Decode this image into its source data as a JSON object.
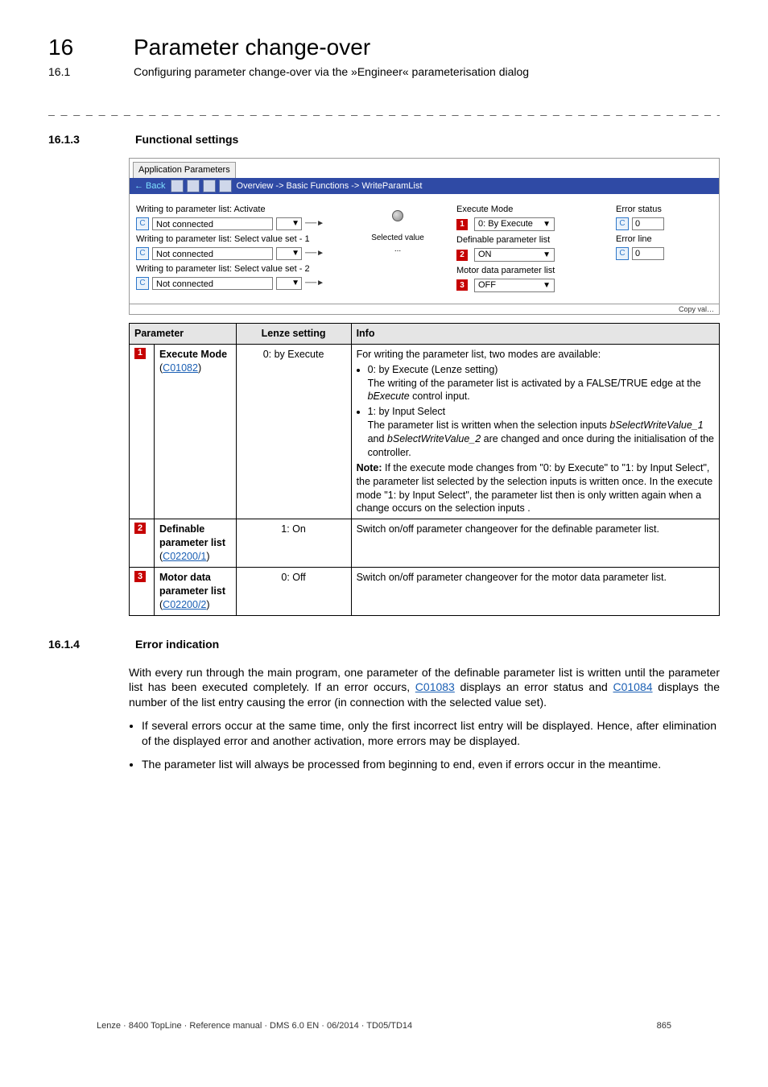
{
  "chapter": {
    "num": "16",
    "title": "Parameter change-over"
  },
  "sub": {
    "num": "16.1",
    "title": "Configuring parameter change-over via the »Engineer« parameterisation dialog"
  },
  "dashes": "_ _ _ _ _ _ _ _ _ _ _ _ _ _ _ _ _ _ _ _ _ _ _ _ _ _ _ _ _ _ _ _ _ _ _ _ _ _ _ _ _ _ _ _ _ _ _ _ _ _ _ _ _ _ _ _ _ _ _ _ _ _",
  "sec1": {
    "num": "16.1.3",
    "title": "Functional settings"
  },
  "app": {
    "tab": "Application Parameters",
    "back": "← Back",
    "breadcrumb": "Overview -> Basic Functions -> WriteParamList",
    "left": {
      "l1": "Writing to parameter list: Activate",
      "l2": "Writing to parameter list: Select value set - 1",
      "l3": "Writing to parameter list: Select value set - 2",
      "nc": "Not connected",
      "selval": "Selected value",
      "ellipsis": "..."
    },
    "right": {
      "exec_mode_l": "Execute Mode",
      "exec_mode_v": "0: By Execute",
      "def_list_l": "Definable parameter list",
      "def_list_v": "ON",
      "motor_list_l": "Motor data parameter list",
      "motor_list_v": "OFF",
      "err_status": "Error status",
      "err_line": "Error line",
      "zero": "0"
    },
    "copy": "Copy val…"
  },
  "table": {
    "h1": "Parameter",
    "h2": "Lenze setting",
    "h3": "Info",
    "rows": [
      {
        "n": "1",
        "name": "Execute Mode",
        "code": "C01082",
        "lenze": "0: by Execute",
        "info_intro": "For writing the parameter list, two modes are available:",
        "b0_head": "0: by Execute (Lenze setting)",
        "b0_body_a": "The writing of the parameter list is activated by a FALSE/TRUE edge at the ",
        "b0_body_b": "bExecute",
        "b0_body_c": " control input.",
        "b1_head": "1: by Input Select",
        "b1_body_a": "The parameter list is written when the selection inputs ",
        "b1_body_b": "bSelectWriteValue_1",
        "b1_body_c": " and ",
        "b1_body_d": "bSelectWriteValue_2",
        "b1_body_e": " are changed and once during the initialisation of the controller.",
        "note_label": "Note:",
        "note_body": " If the execute mode changes from \"0: by Execute\" to \"1: by Input Select\", the parameter list selected by the selection inputs is written once. In the execute mode \"1: by Input Select\", the parameter list then is only written again when a change occurs on the selection inputs  ."
      },
      {
        "n": "2",
        "name": "Definable parameter list",
        "code": "C02200/1",
        "lenze": "1: On",
        "info": "Switch on/off parameter changeover for the definable parameter list."
      },
      {
        "n": "3",
        "name": "Motor data parameter list",
        "code": "C02200/2",
        "lenze": "0: Off",
        "info": "Switch on/off parameter changeover for the motor data parameter list."
      }
    ]
  },
  "sec2": {
    "num": "16.1.4",
    "title": "Error indication"
  },
  "p1_a": "With every run through the main program, one parameter of the definable parameter list is written until the parameter list has been executed completely. If an error occurs, ",
  "p1_link1": "C01083",
  "p1_b": " displays an error status and ",
  "p1_link2": "C01084",
  "p1_c": " displays the number of the list entry causing the error (in connection with the selected value set).",
  "bul1": "If several errors occur at the same time, only the first incorrect list entry will be displayed. Hence, after elimination of the displayed error and another activation, more errors may be displayed.",
  "bul2": "The parameter list will always be processed from beginning to end, even if errors occur in the meantime.",
  "footer_left": "Lenze · 8400 TopLine · Reference manual · DMS 6.0 EN · 06/2014 · TD05/TD14",
  "footer_right": "865"
}
